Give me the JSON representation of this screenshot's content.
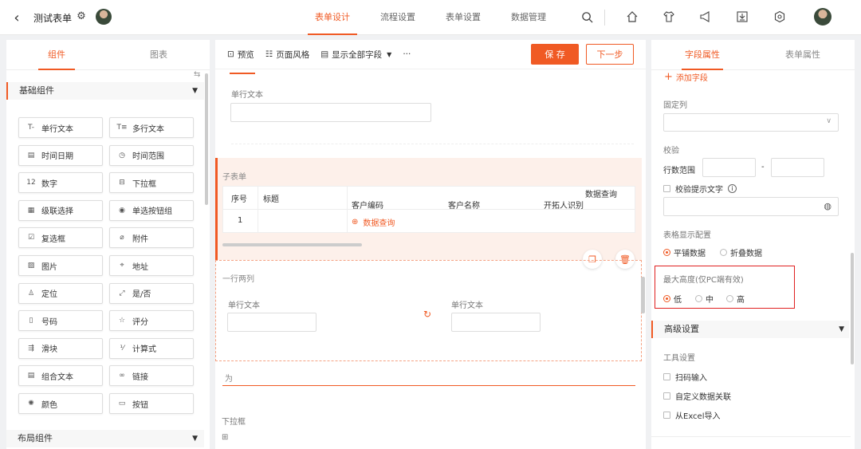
{
  "app": {
    "title": "测试表单"
  },
  "nav_tabs": [
    "表单设计",
    "流程设置",
    "表单设置",
    "数据管理"
  ],
  "left_panel": {
    "tabs": [
      "组件",
      "图表"
    ],
    "basic_section": "基础组件",
    "layout_section": "布局组件",
    "components": [
      {
        "label": "单行文本",
        "icon": "T-"
      },
      {
        "label": "多行文本",
        "icon": "T≡"
      },
      {
        "label": "时间日期",
        "icon": "▤"
      },
      {
        "label": "时间范围",
        "icon": "◷"
      },
      {
        "label": "数字",
        "icon": "12"
      },
      {
        "label": "下拉框",
        "icon": "⊟"
      },
      {
        "label": "级联选择",
        "icon": "▦"
      },
      {
        "label": "单选按钮组",
        "icon": "◉"
      },
      {
        "label": "复选框",
        "icon": "☑"
      },
      {
        "label": "附件",
        "icon": "⌀"
      },
      {
        "label": "图片",
        "icon": "▨"
      },
      {
        "label": "地址",
        "icon": "⌖"
      },
      {
        "label": "定位",
        "icon": "♙"
      },
      {
        "label": "是/否",
        "icon": "⤢"
      },
      {
        "label": "号码",
        "icon": "▯"
      },
      {
        "label": "评分",
        "icon": "☆"
      },
      {
        "label": "滑块",
        "icon": "⇶"
      },
      {
        "label": "计算式",
        "icon": "⅟"
      },
      {
        "label": "组合文本",
        "icon": "▤"
      },
      {
        "label": "链接",
        "icon": "∞"
      },
      {
        "label": "颜色",
        "icon": "✺"
      },
      {
        "label": "按钮",
        "icon": "▭"
      }
    ]
  },
  "toolbar": {
    "preview": "预览",
    "style": "页面风格",
    "show_all": "显示全部字段",
    "more": "···",
    "save": "保 存",
    "next": "下一步"
  },
  "canvas": {
    "single_text_label": "单行文本",
    "subform": {
      "title": "子表单",
      "headers": [
        "序号",
        "标题",
        "客户编码",
        "客户名称",
        "开拓人识别",
        "数据查询"
      ],
      "row_index": "1",
      "query_link": "数据查询"
    },
    "two_col": {
      "title": "一行两列",
      "left_label": "单行文本",
      "right_label": "单行文本"
    },
    "wei_field": "为",
    "dropdown_label": "下拉框"
  },
  "right_panel": {
    "tabs": [
      "字段属性",
      "表单属性"
    ],
    "add_field": "添加字段",
    "fixed_col": "固定列",
    "validation": "校验",
    "row_range": "行数范围",
    "range_sep": "-",
    "hint_text": "校验提示文字",
    "table_display": "表格显示配置",
    "display_options": [
      "平铺数据",
      "折叠数据"
    ],
    "max_height": "最大高度(仅PC端有效)",
    "height_options": [
      "低",
      "中",
      "高"
    ],
    "advanced": "高级设置",
    "tool_settings": "工具设置",
    "tools": [
      "扫码输入",
      "自定义数据关联",
      "从Excel导入"
    ]
  },
  "colors": {
    "accent": "#f05a24",
    "highlight_box": "#e02020",
    "subform_bg": "#fdf0ea"
  }
}
